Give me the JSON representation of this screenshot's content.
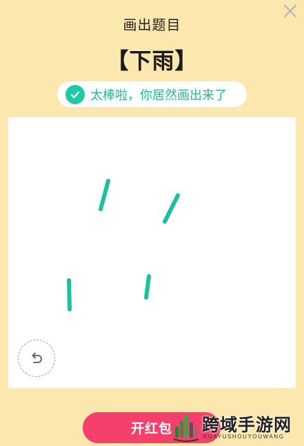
{
  "header": {
    "title": "画出题目",
    "close_icon": "close-icon"
  },
  "topic": {
    "text": "【下雨】"
  },
  "result": {
    "icon": "checkmark-icon",
    "message": "太棒啦，你居然画出来了",
    "accent_color": "#1DC9A6"
  },
  "canvas": {
    "stroke_color": "#1DBFA3",
    "undo_icon": "undo-icon"
  },
  "footer": {
    "button_label": "开红包",
    "button_color": "#F4406A"
  },
  "watermark": {
    "text": "跨域手游网",
    "subtext": "KUAYUSHOUYOUWANG"
  }
}
